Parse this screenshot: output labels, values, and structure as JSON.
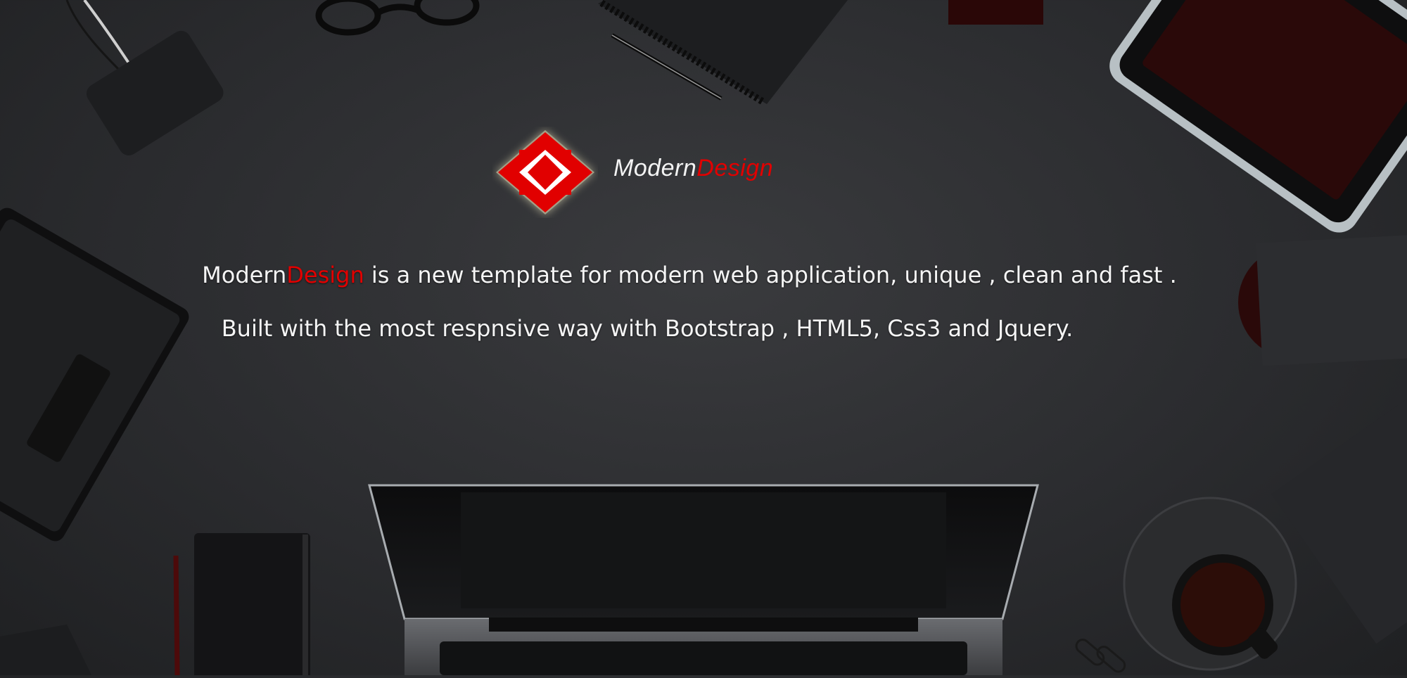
{
  "brand": {
    "part1": "Modern",
    "part2": "Design"
  },
  "tagline": {
    "line1_brand_part1": "Modern",
    "line1_brand_part2": "Design",
    "line1_rest": " is a new template for modern web application, unique , clean and fast .",
    "line2": "Built with the most respnsive way with Bootstrap , HTML5, Css3  and Jquery."
  },
  "colors": {
    "accent": "#e10000",
    "background": "#2e2f32",
    "text": "#f5f5f5"
  }
}
